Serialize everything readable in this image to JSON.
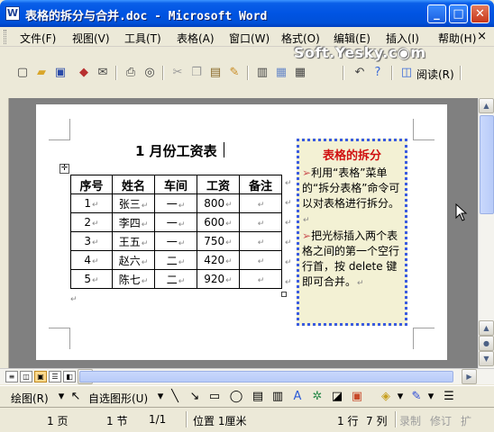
{
  "window": {
    "app_icon": "W",
    "title": "表格的拆分与合并.doc - Microsoft Word",
    "minimize": "_",
    "maximize": "□",
    "close": "✕"
  },
  "menubar": {
    "items": [
      "文件(F)",
      "视图(V)",
      "工具(T)",
      "表格(A)",
      "窗口(W)",
      "格式(O)",
      "编辑(E)",
      "插入(I)",
      "帮助(H)"
    ],
    "close_doc": "×"
  },
  "toolbar": {
    "reading_label": "阅读(R)",
    "watermark": "Soft.Yesky.c◉m",
    "icons": [
      "new-icon",
      "open-icon",
      "save-icon",
      "permission-icon",
      "email-icon",
      "print-icon",
      "print-preview-icon",
      "cut-icon",
      "copy-icon",
      "paste-icon",
      "format-painter-icon",
      "columns-icon",
      "text-box-icon",
      "table-icon",
      "undo-icon",
      "help-icon",
      "read-icon"
    ]
  },
  "document": {
    "title": "1 月份工资表",
    "table": {
      "headers": [
        "序号",
        "姓名",
        "车间",
        "工资",
        "备注"
      ],
      "rows": [
        [
          "1",
          "张三",
          "一",
          "800",
          ""
        ],
        [
          "2",
          "李四",
          "一",
          "600",
          ""
        ],
        [
          "3",
          "王五",
          "一",
          "750",
          ""
        ],
        [
          "4",
          "赵六",
          "二",
          "420",
          ""
        ],
        [
          "5",
          "陈七",
          "二",
          "920",
          ""
        ]
      ]
    },
    "tip": {
      "title": "表格的拆分",
      "arrow": "➢",
      "item1": "利用“表格”菜单的“拆分表格”命令可以对表格进行拆分。",
      "item2": "把光标插入两个表格之间的第一个空行行首，按 delete 键即可合并。"
    },
    "para_mark": "↵",
    "move_handle": "✛"
  },
  "drawbar": {
    "draw_label": "绘图(R)",
    "autoshape_label": "自选图形(U)"
  },
  "statusbar": {
    "page": "1 页",
    "section": "1 节",
    "page_of": "1/1",
    "position": "位置 1厘米",
    "line": "1 行",
    "column": "7 列",
    "rec": "录制",
    "trk": "修订",
    "ext": "扩"
  },
  "colors": {
    "titlebar": "#0054e3",
    "tip_border": "#3a5be0",
    "tip_title": "#d01010",
    "tip_bg": "#f3f1d4"
  }
}
